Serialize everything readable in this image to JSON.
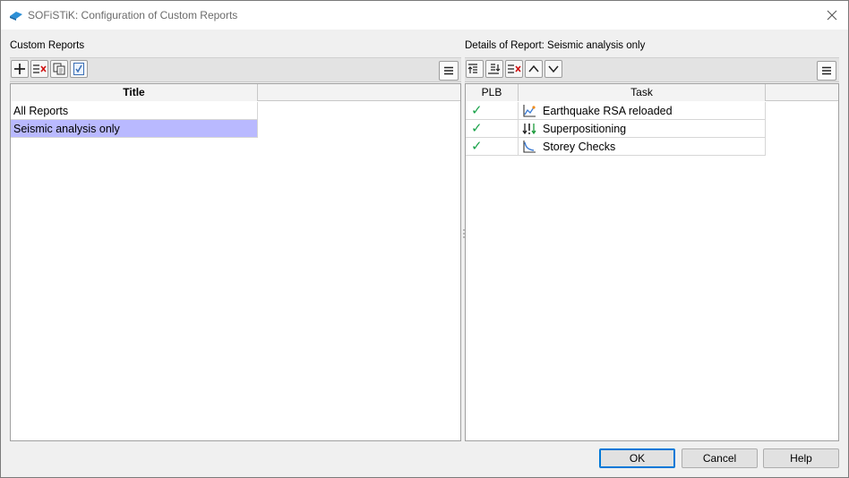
{
  "window": {
    "title": "SOFiSTiK: Configuration of Custom Reports"
  },
  "left_panel": {
    "label": "Custom Reports",
    "column_title": "Title",
    "rows": [
      {
        "title": "All Reports",
        "selected": false
      },
      {
        "title": "Seismic analysis only",
        "selected": true
      }
    ]
  },
  "right_panel": {
    "label": "Details of Report: Seismic analysis only",
    "columns": {
      "plb": "PLB",
      "task": "Task"
    },
    "rows": [
      {
        "plb": "✓",
        "task": "Earthquake RSA reloaded",
        "icon": "rsa-chart-icon"
      },
      {
        "plb": "✓",
        "task": "Superpositioning",
        "icon": "superposition-icon"
      },
      {
        "plb": "✓",
        "task": "Storey Checks",
        "icon": "storey-chart-icon"
      }
    ]
  },
  "buttons": {
    "ok": "OK",
    "cancel": "Cancel",
    "help": "Help"
  },
  "colors": {
    "selection": "#b9b9ff",
    "check": "#1aa34a",
    "default_button_border": "#0078d7"
  }
}
